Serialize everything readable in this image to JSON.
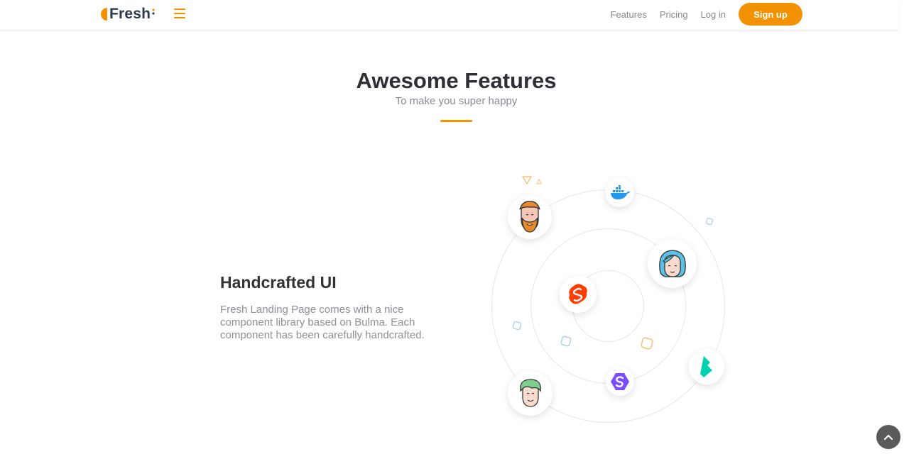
{
  "brand": {
    "name": "Fresh",
    "accent": "#f39200"
  },
  "nav": {
    "links": [
      "Features",
      "Pricing",
      "Log in"
    ],
    "signup_label": "Sign up"
  },
  "section": {
    "title": "Awesome Features",
    "subtitle": "To make you super happy"
  },
  "feature": {
    "title": "Handcrafted UI",
    "text": "Fresh Landing Page comes with a nice component library based on Bulma. Each component has been carefully handcrafted."
  },
  "icons": {
    "menu": "hamburger-menu-icon",
    "scroll_top": "chevron-up-icon",
    "orbit_items": [
      "bearded-man-avatar",
      "docker-icon",
      "woman-avatar",
      "svelte-icon",
      "bulma-icon",
      "stimulus-icon",
      "man-avatar"
    ]
  }
}
